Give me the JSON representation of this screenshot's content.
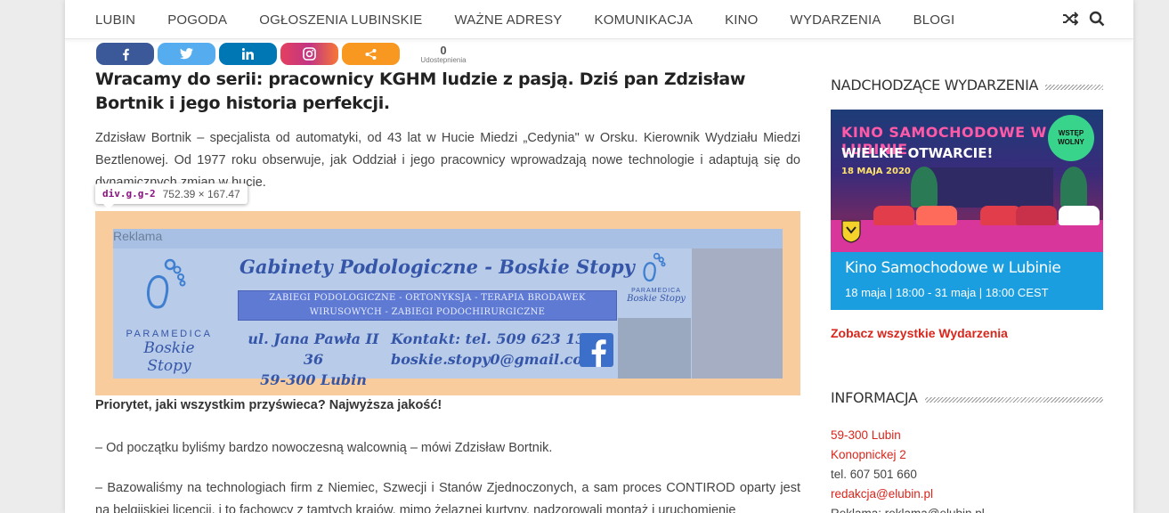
{
  "nav": {
    "items": [
      "LUBIN",
      "POGODA",
      "OGŁOSZENIA LUBINSKIE",
      "WAŻNE ADRESY",
      "KOMUNIKACJA",
      "KINO",
      "WYDARZENIA",
      "BLOGI"
    ],
    "icons": [
      "shuffle-icon",
      "search-icon"
    ]
  },
  "share": {
    "buttons": [
      "facebook-icon",
      "twitter-icon",
      "linkedin-icon",
      "instagram-icon",
      "share-icon"
    ],
    "count": "0",
    "count_label": "Udostepnienia"
  },
  "article": {
    "title": "Wracamy do serii: pracownicy KGHM ludzie z pasją. Dziś pan Zdzisław Bortnik i jego historia perfekcji.",
    "intro": "Zdzisław Bortnik – specjalista od automatyki, od 43 lat w Hucie Miedzi „Cedynia\" w Orsku. Kierownik Wydziału Miedzi Beztlenowej. Od 1977 roku obserwuje, jak Oddział i jego pracownicy wprowadzają nowe technologie i adaptują się do dynamicznych zmian w hucie.",
    "bold_line": "Priorytet, jaki wszystkim przyświeca? Najwyższa jakość!",
    "p2": "– Od początku byliśmy bardzo nowoczesną walcownią – mówi Zdzisław Bortnik.",
    "p3": "– Bazowaliśmy na technologiach firm z Niemiec, Szwecji i Stanów Zjednoczonych, a sam proces CONTIROD oparty jest na belgijskiej licencji, i to fachowcy z tamtych krajów, mimo żelaznej kurtyny, nadzorowali montaż i uruchomienie"
  },
  "devtools_tooltip": {
    "tag": "div.g.g-2",
    "dimensions": "752.39 × 167.47"
  },
  "ad": {
    "label": "Reklama",
    "title": "Gabinety Podologiczne - Boskie Stopy",
    "services_line1": "ZABIEGI PODOLOGICZNE - ORTONYKSJA - TERAPIA BRODAWEK",
    "services_line2": "WIRUSOWYCH - ZABIEGI PODOCHIRURGICZNE",
    "address_line1": "ul. Jana Pawła II 36",
    "address_line2": "59-300 Lubin",
    "contact_line1": "Kontakt: tel. 509 623 132",
    "contact_line2": "boskie.stopy0@gmail.com",
    "brand_top": "PARAMEDICA",
    "brand_bottom": "Boskie Stopy",
    "brand_small_top": "PARAMEDICA",
    "brand_small_bottom": "Boskie Stopy"
  },
  "sidebar": {
    "events_heading": "NADCHODZĄCE WYDARZENIA",
    "event_image": {
      "line1": "KINO SAMOCHODOWE W LUBINIE",
      "line2": "WIELKIE OTWARCIE!",
      "line3": "18 MAJA 2020",
      "badge": "WSTĘP WOLNY"
    },
    "event_title": "Kino Samochodowe w Lubinie",
    "event_dates": "18 maja | 18:00 - 31 maja | 18:00 CEST",
    "all_events_link": "Zobacz wszystkie Wydarzenia",
    "info_heading": "INFORMACJA",
    "info": {
      "city": "59-300 Lubin",
      "street": "Konopnickej 2",
      "phone": "tel. 607 501 660",
      "email": "redakcja@elubin.pl",
      "ads": "Reklama: reklama@elubin.pl"
    }
  },
  "colors": {
    "accent_red": "#d9261c",
    "event_blue": "#1a9ee0",
    "facebook": "#3b5998",
    "twitter": "#55acee",
    "linkedin": "#0077b5",
    "share_orange": "#f89820",
    "ad_highlight_padding": "#f9cc9d",
    "ad_highlight_content": "#a9c0e5"
  }
}
